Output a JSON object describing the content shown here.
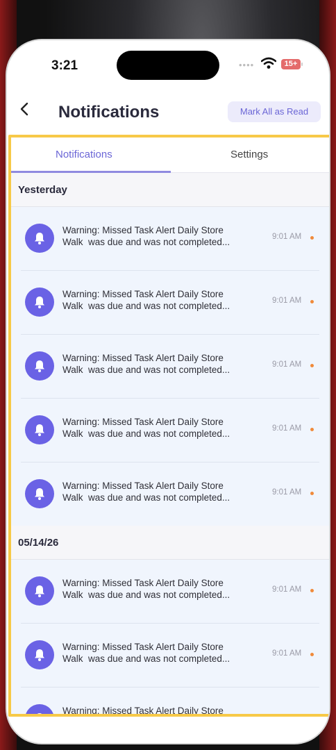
{
  "status": {
    "time": "3:21",
    "battery": "15+"
  },
  "header": {
    "title": "Notifications",
    "mark_all": "Mark All as Read"
  },
  "tabs": [
    {
      "label": "Notifications",
      "active": true
    },
    {
      "label": "Settings",
      "active": false
    }
  ],
  "sections": [
    {
      "label": "Yesterday",
      "items": [
        {
          "line1": "Warning: Missed Task Alert Daily Store",
          "line2": "Walk  was due and was not completed...",
          "time": "9:01 AM",
          "unread": true
        },
        {
          "line1": "Warning: Missed Task Alert Daily Store",
          "line2": "Walk  was due and was not completed...",
          "time": "9:01 AM",
          "unread": true
        },
        {
          "line1": "Warning: Missed Task Alert Daily Store",
          "line2": "Walk  was due and was not completed...",
          "time": "9:01 AM",
          "unread": true
        },
        {
          "line1": "Warning: Missed Task Alert Daily Store",
          "line2": "Walk  was due and was not completed...",
          "time": "9:01 AM",
          "unread": true
        },
        {
          "line1": "Warning: Missed Task Alert Daily Store",
          "line2": "Walk  was due and was not completed...",
          "time": "9:01 AM",
          "unread": true
        }
      ]
    },
    {
      "label": "05/14/26",
      "items": [
        {
          "line1": "Warning: Missed Task Alert Daily Store",
          "line2": "Walk  was due and was not completed...",
          "time": "9:01 AM",
          "unread": true
        },
        {
          "line1": "Warning: Missed Task Alert Daily Store",
          "line2": "Walk  was due and was not completed...",
          "time": "9:01 AM",
          "unread": true
        },
        {
          "line1": "Warning: Missed Task Alert Daily Store",
          "line2": "",
          "time": "",
          "unread": false
        }
      ]
    }
  ],
  "colors": {
    "accent": "#6b66d6",
    "bell": "#6a62e5",
    "unread_dot": "#f08a3a",
    "highlight_frame": "#f7c948"
  },
  "icons": {
    "back": "chevron-left-icon",
    "notification": "bell-icon",
    "wifi": "wifi-icon"
  }
}
